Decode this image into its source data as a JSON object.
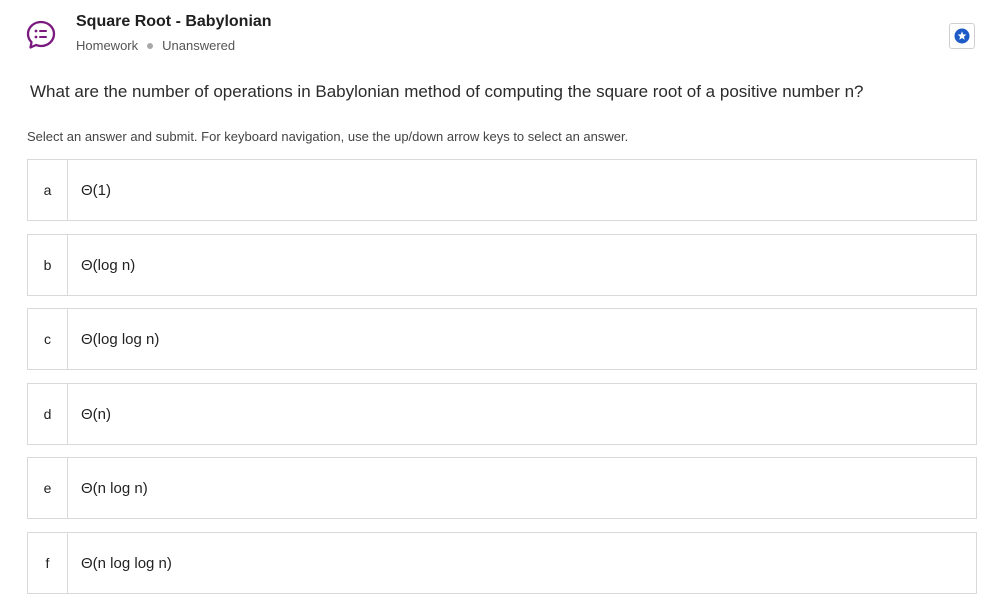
{
  "header": {
    "title": "Square Root - Babylonian",
    "type": "Homework",
    "status": "Unanswered",
    "icon": "quiz-list-icon",
    "accent_color": "#7a1a7e",
    "bookmark_icon": "star-badge-icon",
    "bookmark_color": "#1e5bc6"
  },
  "question": {
    "text": "What are the number of operations in Babylonian method of computing the square root of a positive number n?",
    "instructions": "Select an answer and submit. For keyboard navigation, use the up/down arrow keys to select an answer."
  },
  "options": [
    {
      "letter": "a",
      "text": "Θ(1)"
    },
    {
      "letter": "b",
      "text": "Θ(log n)"
    },
    {
      "letter": "c",
      "text": "Θ(log log n)"
    },
    {
      "letter": "d",
      "text": "Θ(n)"
    },
    {
      "letter": "e",
      "text": "Θ(n log n)"
    },
    {
      "letter": "f",
      "text": "Θ(n log log n)"
    }
  ]
}
